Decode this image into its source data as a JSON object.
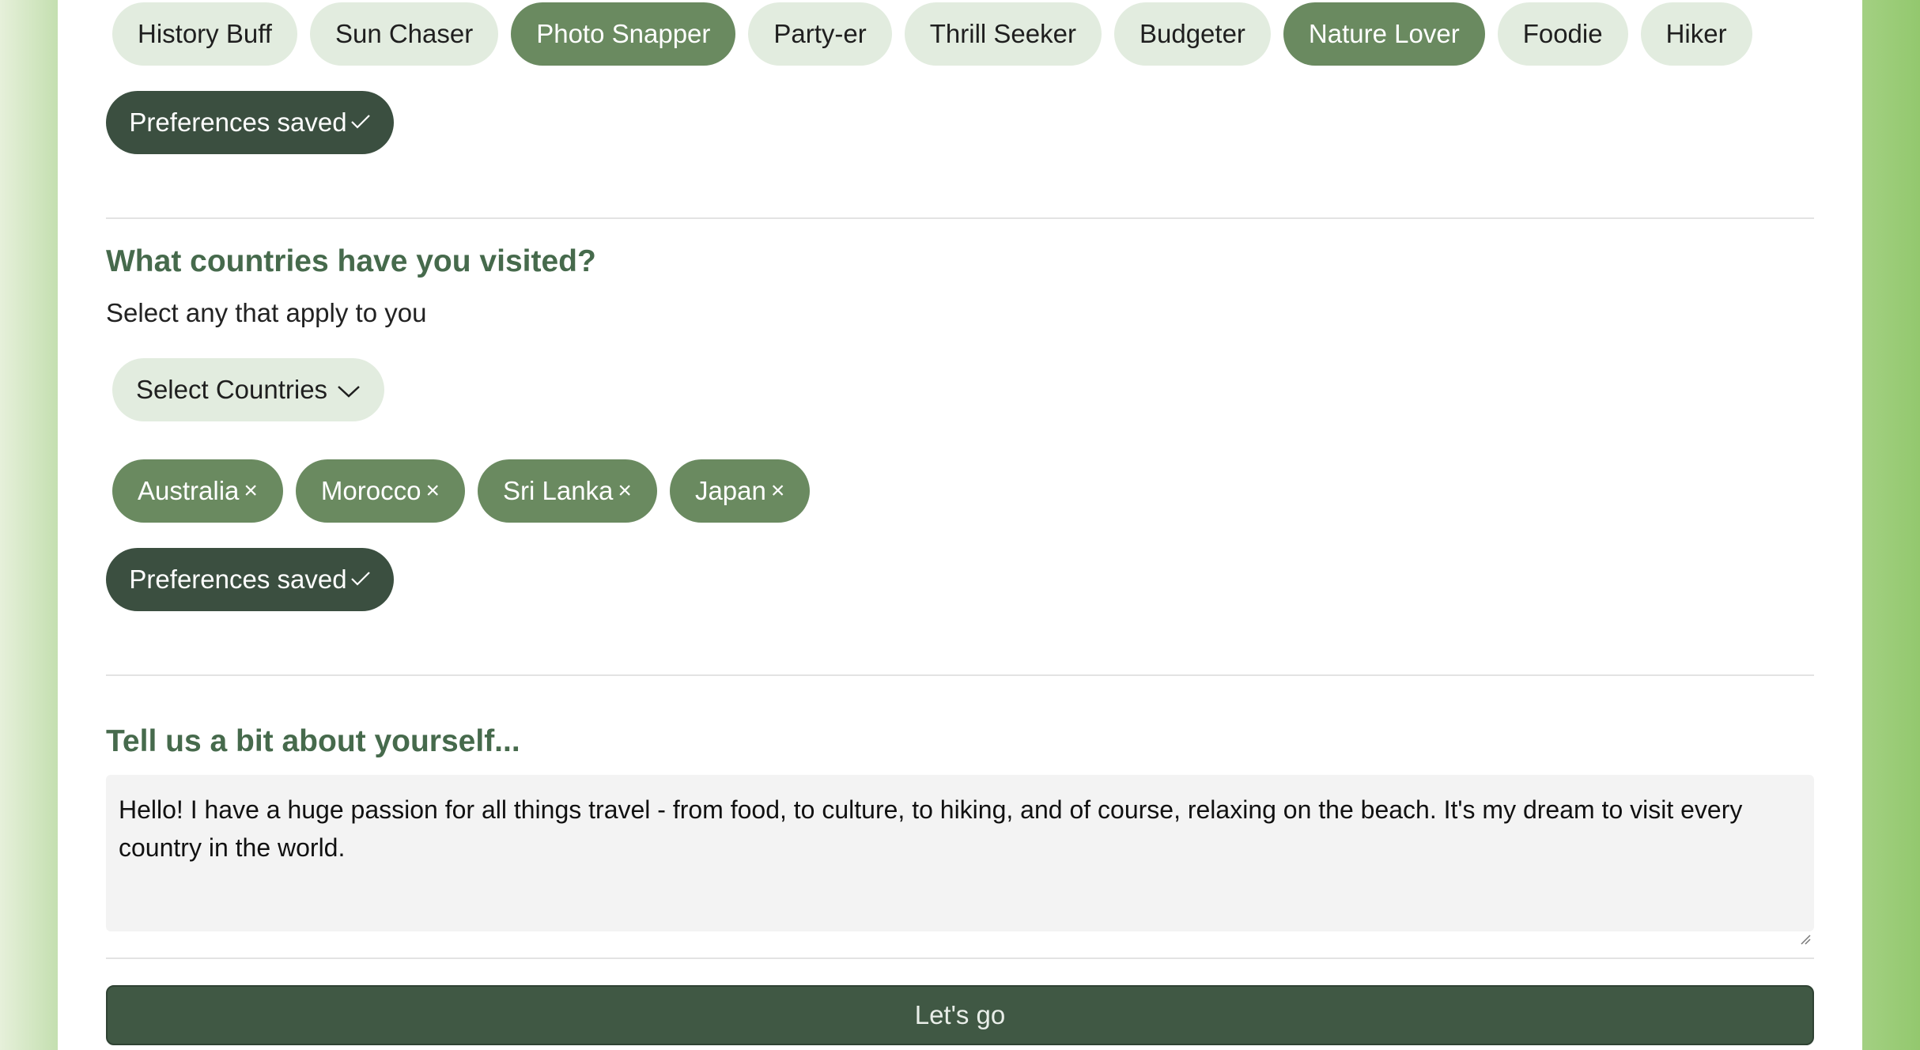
{
  "interests": {
    "chips": [
      {
        "label": "History Buff",
        "selected": false
      },
      {
        "label": "Sun Chaser",
        "selected": false
      },
      {
        "label": "Photo Snapper",
        "selected": true
      },
      {
        "label": "Party-er",
        "selected": false
      },
      {
        "label": "Thrill Seeker",
        "selected": false
      },
      {
        "label": "Budgeter",
        "selected": false
      },
      {
        "label": "Nature Lover",
        "selected": true
      },
      {
        "label": "Foodie",
        "selected": false
      },
      {
        "label": "Hiker",
        "selected": false
      }
    ],
    "saved_label": "Preferences saved"
  },
  "countries": {
    "heading": "What countries have you visited?",
    "subtext": "Select any that apply to you",
    "dropdown_label": "Select Countries",
    "selected": [
      "Australia",
      "Morocco",
      "Sri Lanka",
      "Japan"
    ],
    "remove_glyph": "×",
    "saved_label": "Preferences saved"
  },
  "about": {
    "heading": "Tell us a bit about yourself...",
    "text": "Hello! I have a huge passion for all things travel - from food, to culture, to hiking, and of course, relaxing on the beach. It's my dream to visit every country in the world."
  },
  "submit_label": "Let's go",
  "colors": {
    "chip_bg": "#e2ecdf",
    "chip_selected_bg": "#6a8a60",
    "dark_button": "#3b4f40",
    "heading": "#466a4c",
    "submit_bg": "#405844"
  }
}
